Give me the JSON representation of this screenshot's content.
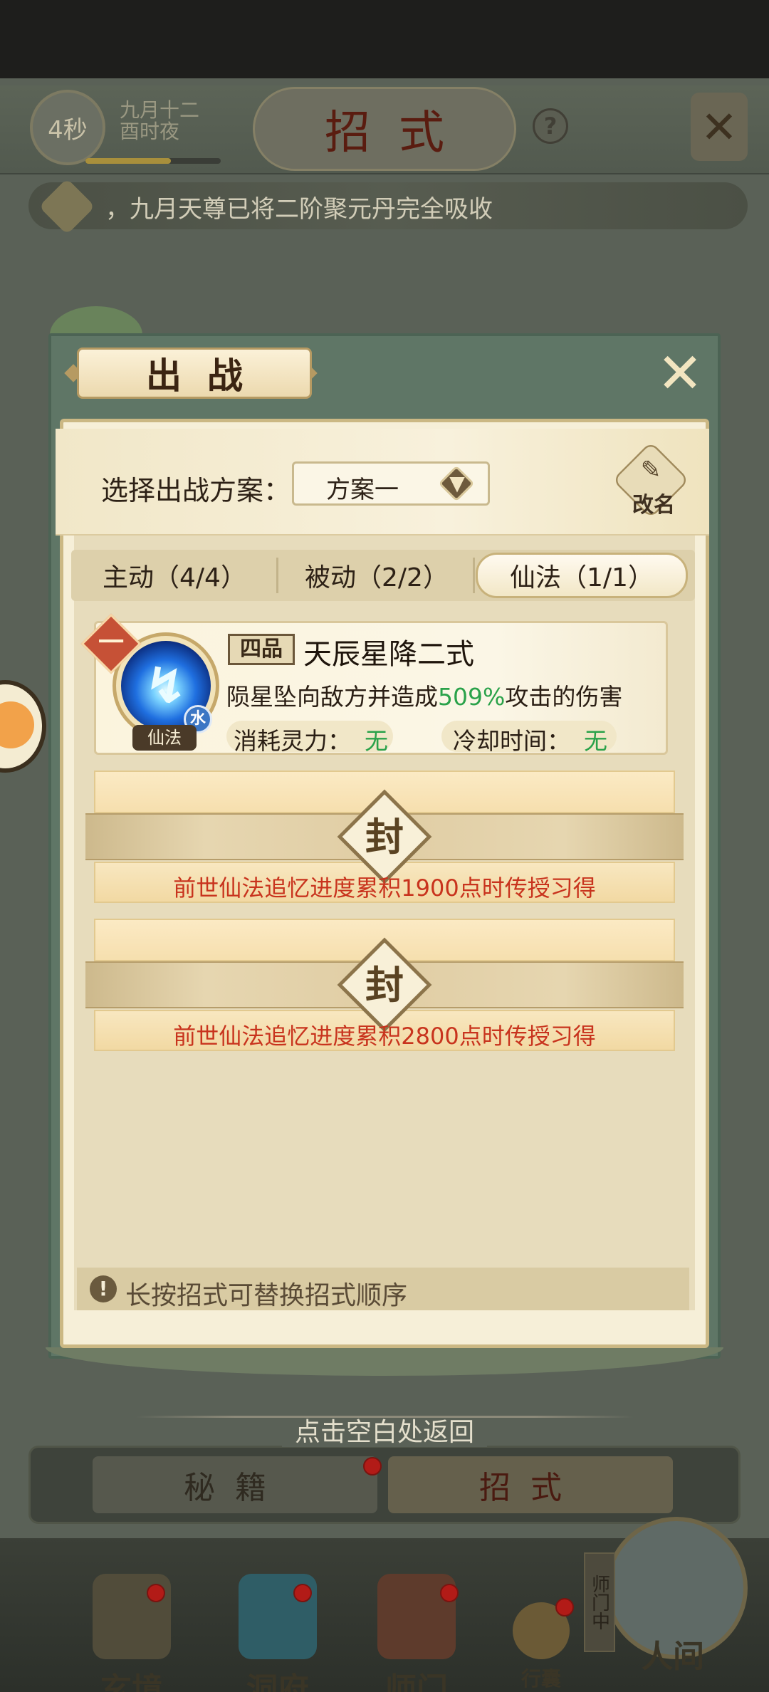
{
  "background": {
    "timer": "4秒",
    "date_line1": "九月十二",
    "date_line2": "酉时夜",
    "screen_title": "招式",
    "help_icon": "?",
    "notice": "，九月天尊已将二阶聚元丹完全吸收",
    "bottom_tabs": [
      "秘籍",
      "招式"
    ],
    "nav": [
      "玄境",
      "洞府",
      "师门",
      "行囊",
      "人间"
    ],
    "nav_shimen_tag": "师门中"
  },
  "dialog": {
    "title": "出战",
    "scheme_label": "选择出战方案：",
    "scheme_value": "方案一",
    "rename_label": "改名",
    "tabs": {
      "active": "主动（4/4）",
      "passive": "被动（2/2）",
      "magic": "仙法（1/1）"
    },
    "skill": {
      "slot": "一",
      "grade": "四品",
      "name": "天辰星降二式",
      "desc_pre": "陨星坠向敌方并造成",
      "desc_pct": "509%",
      "desc_post": "攻击的伤害",
      "type": "仙法",
      "element": "水",
      "cost_label": "消耗灵力：",
      "cost_value": "无",
      "cooldown_label": "冷却时间：",
      "cooldown_value": "无"
    },
    "locked": [
      {
        "seal": "封",
        "text": "前世仙法追忆进度累积1900点时传授习得"
      },
      {
        "seal": "封",
        "text": "前世仙法追忆进度累积2800点时传授习得"
      }
    ],
    "hint": "长按招式可替换招式顺序",
    "return_text": "点击空白处返回"
  },
  "colors": {
    "accent_green": "#2aa24a",
    "locked_red": "#c8331d",
    "dialog_frame": "#5f7666"
  }
}
